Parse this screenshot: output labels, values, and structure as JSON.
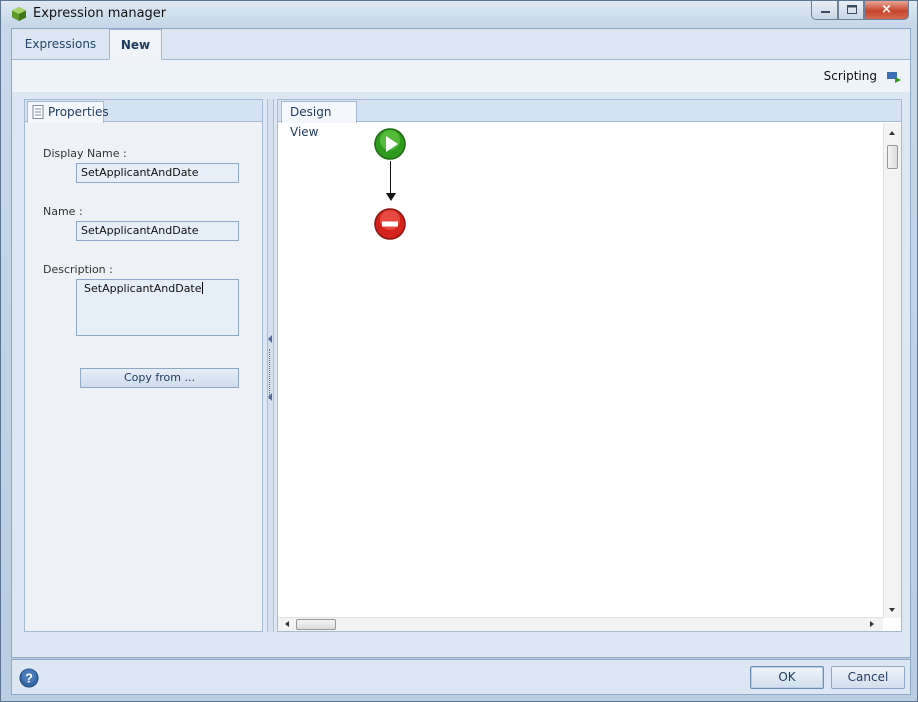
{
  "window": {
    "title": "Expression manager",
    "icon": "app-cube-icon"
  },
  "window_controls": {
    "minimize": "minimize-icon",
    "maximize": "maximize-icon",
    "close": "×"
  },
  "tabs": [
    {
      "label": "Expressions",
      "selected": false
    },
    {
      "label": "New",
      "selected": true
    }
  ],
  "ribbon": {
    "scripting_label": "Scripting"
  },
  "properties": {
    "tab_label": "Properties",
    "display_name_label": "Display Name :",
    "display_name_value": "SetApplicantAndDate",
    "name_label": "Name :",
    "name_value": "SetApplicantAndDate",
    "description_label": "Description :",
    "description_value": "SetApplicantAndDate",
    "copy_button": "Copy from ..."
  },
  "design": {
    "tab_label": "Design View",
    "start_node": "play-start-icon",
    "end_node": "stop-end-icon"
  },
  "footer": {
    "ok": "OK",
    "cancel": "Cancel",
    "help": "?"
  },
  "colors": {
    "accent": "#1d3a5f",
    "start": "#2e9b1e",
    "end": "#d4221c"
  }
}
